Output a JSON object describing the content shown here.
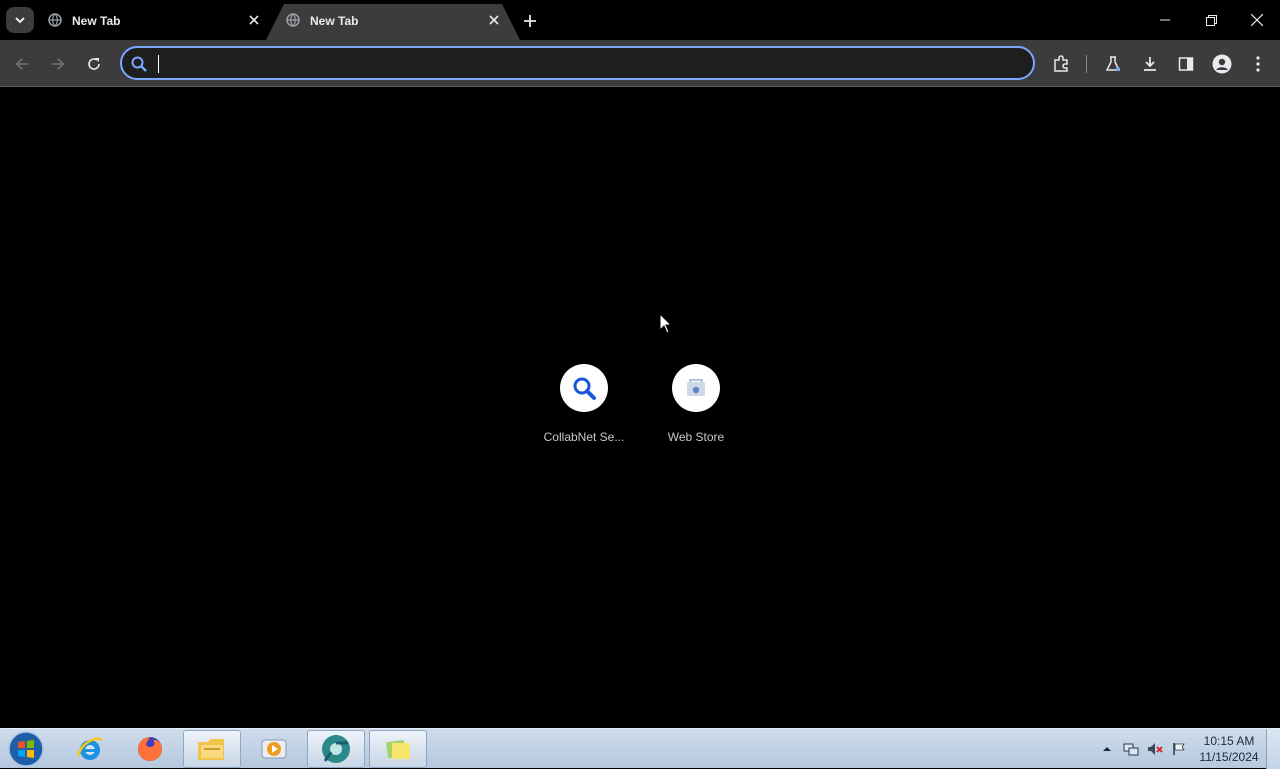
{
  "browser": {
    "tabs": [
      {
        "title": "New Tab",
        "icon": "globe-icon"
      },
      {
        "title": "New Tab",
        "icon": "globe-icon"
      }
    ],
    "omnibox": {
      "value": "",
      "placeholder": ""
    },
    "accent_color": "#7aa7ff"
  },
  "shortcuts": [
    {
      "label": "CollabNet Se...",
      "icon": "search-icon"
    },
    {
      "label": "Web Store",
      "icon": "web-store-icon"
    }
  ],
  "taskbar": {
    "apps": [
      "internet-explorer-icon",
      "firefox-icon",
      "file-explorer-icon",
      "media-player-icon",
      "chromium-icon",
      "sticky-notes-icon"
    ],
    "clock": {
      "time": "10:15 AM",
      "date": "11/15/2024"
    }
  }
}
